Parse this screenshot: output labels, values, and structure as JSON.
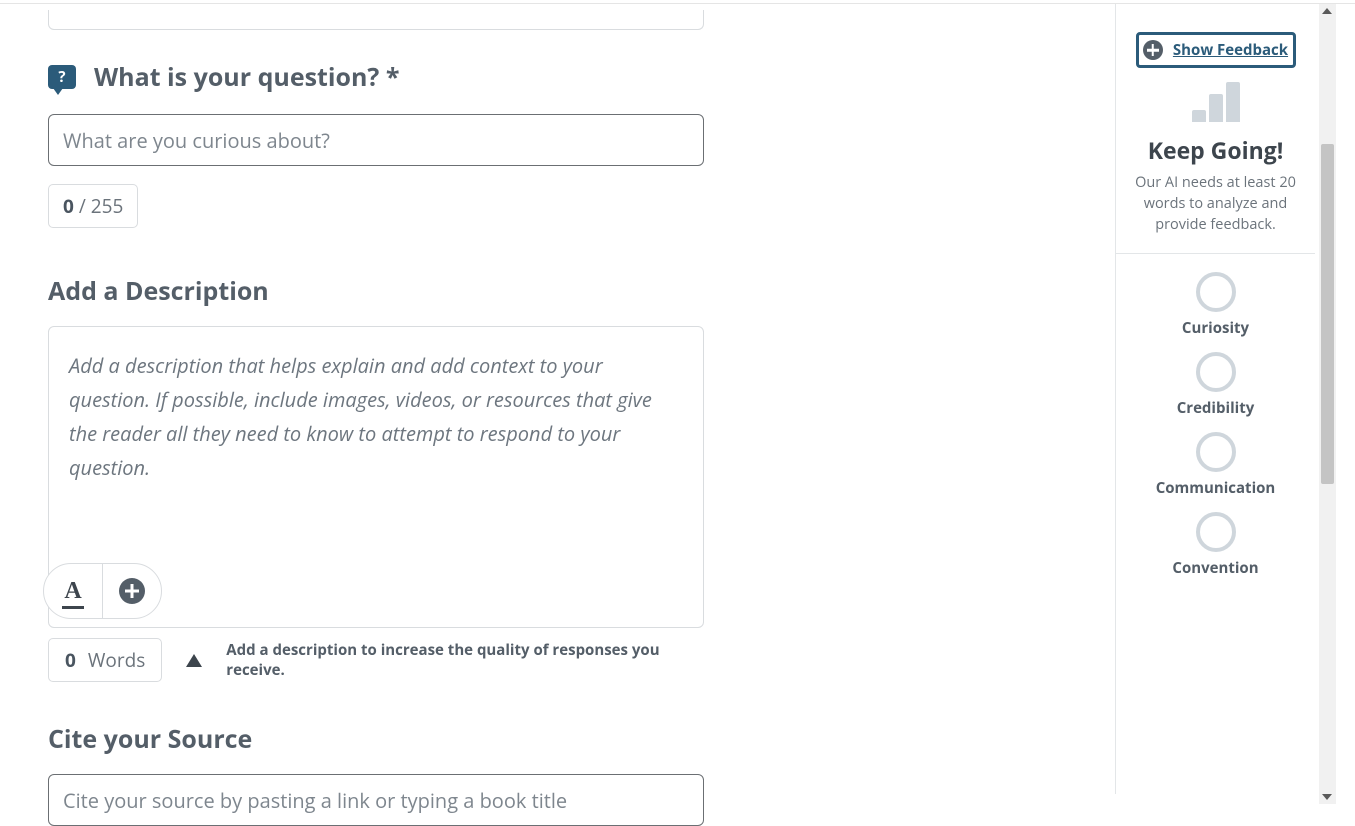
{
  "question": {
    "heading": "What is your question? *",
    "placeholder": "What are you curious about?",
    "count": "0",
    "limit": "/ 255"
  },
  "description": {
    "heading": "Add a Description",
    "placeholder": "Add a description that helps explain and add context to your question. If possible, include images, videos, or resources that give the reader all they need to know to attempt to respond to your question.",
    "word_count": "0",
    "word_label": "Words",
    "hint": "Add a description to increase the quality of responses you receive."
  },
  "source": {
    "heading": "Cite your Source",
    "placeholder": "Cite your source by pasting a link or typing a book title"
  },
  "sidebar": {
    "feedback_label": "Show Feedback",
    "keep_going": "Keep Going!",
    "keep_going_sub": "Our AI needs at least 20 words to analyze and provide feedback.",
    "metrics": [
      "Curiosity",
      "Credibility",
      "Communication",
      "Convention"
    ]
  }
}
